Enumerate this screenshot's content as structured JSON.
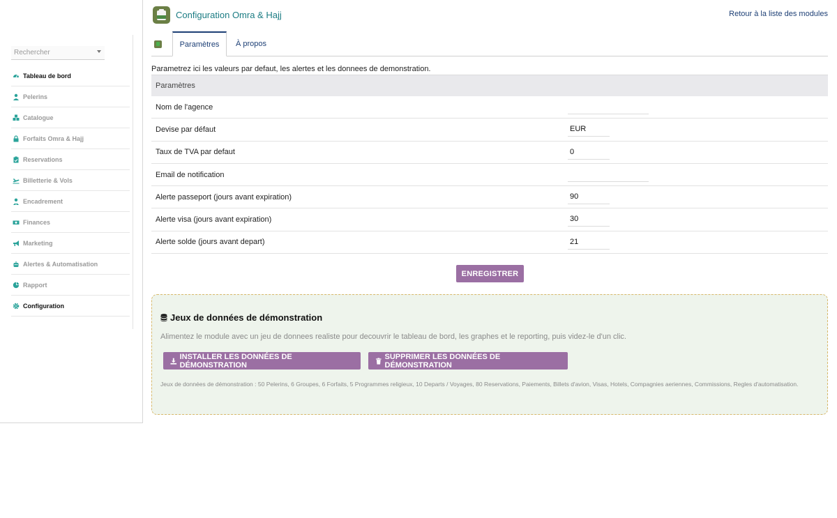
{
  "header": {
    "title": "Configuration Omra & Hajj",
    "back_link": "Retour à la liste des modules"
  },
  "sidebar": {
    "search_placeholder": "Rechercher",
    "items": [
      {
        "label": "Tableau de bord",
        "icon": "dashboard-icon",
        "active": true
      },
      {
        "label": "Pelerins",
        "icon": "user-icon",
        "active": false
      },
      {
        "label": "Catalogue",
        "icon": "catalog-icon",
        "active": false
      },
      {
        "label": "Forfaits Omra & Hajj",
        "icon": "lock-icon",
        "active": false
      },
      {
        "label": "Reservations",
        "icon": "clipboard-icon",
        "active": false
      },
      {
        "label": "Billetterie & Vols",
        "icon": "plane-icon",
        "active": false
      },
      {
        "label": "Encadrement",
        "icon": "guide-icon",
        "active": false
      },
      {
        "label": "Finances",
        "icon": "money-icon",
        "active": false
      },
      {
        "label": "Marketing",
        "icon": "megaphone-icon",
        "active": false
      },
      {
        "label": "Alertes & Automatisation",
        "icon": "robot-icon",
        "active": false
      },
      {
        "label": "Rapport",
        "icon": "pie-chart-icon",
        "active": false
      },
      {
        "label": "Configuration",
        "icon": "gear-icon",
        "active": true
      }
    ]
  },
  "tabs": {
    "params": "Paramètres",
    "about": "À propos"
  },
  "intro": "Parametrez ici les valeurs par defaut, les alertes et les donnees de demonstration.",
  "params": {
    "header": "Paramètres",
    "rows": [
      {
        "label": "Nom de l'agence",
        "value": ""
      },
      {
        "label": "Devise par défaut",
        "value": "EUR"
      },
      {
        "label": "Taux de TVA par defaut",
        "value": "0"
      },
      {
        "label": "Email de notification",
        "value": ""
      },
      {
        "label": "Alerte passeport (jours avant expiration)",
        "value": "90"
      },
      {
        "label": "Alerte visa (jours avant expiration)",
        "value": "30"
      },
      {
        "label": "Alerte solde (jours avant depart)",
        "value": "21"
      }
    ],
    "save_label": "ENREGISTRER"
  },
  "demo": {
    "title": "Jeux de données de démonstration",
    "description": "Alimentez le module avec un jeu de donnees realiste pour decouvrir le tableau de bord, les graphes et le reporting, puis videz-le d'un clic.",
    "install_label": "INSTALLER LES DONNÉES DE DÉMONSTRATION",
    "delete_label": "SUPPRIMER LES DONNÉES DE DÉMONSTRATION",
    "note": "Jeux de données de démonstration : 50 Pelerins, 6 Groupes, 6 Forfaits, 5 Programmes religieux, 10 Departs / Voyages, 80 Reservations, Paiements, Billets d'avion, Visas, Hotels, Compagnies aeriennes, Commissions, Regles d'automatisation."
  },
  "colors": {
    "accent": "#9b6fa3",
    "title": "#1b7c83",
    "link": "#1d3f75",
    "icon": "#2aa39a",
    "demo_bg": "#eef4ec",
    "demo_border": "#d8b86a"
  }
}
